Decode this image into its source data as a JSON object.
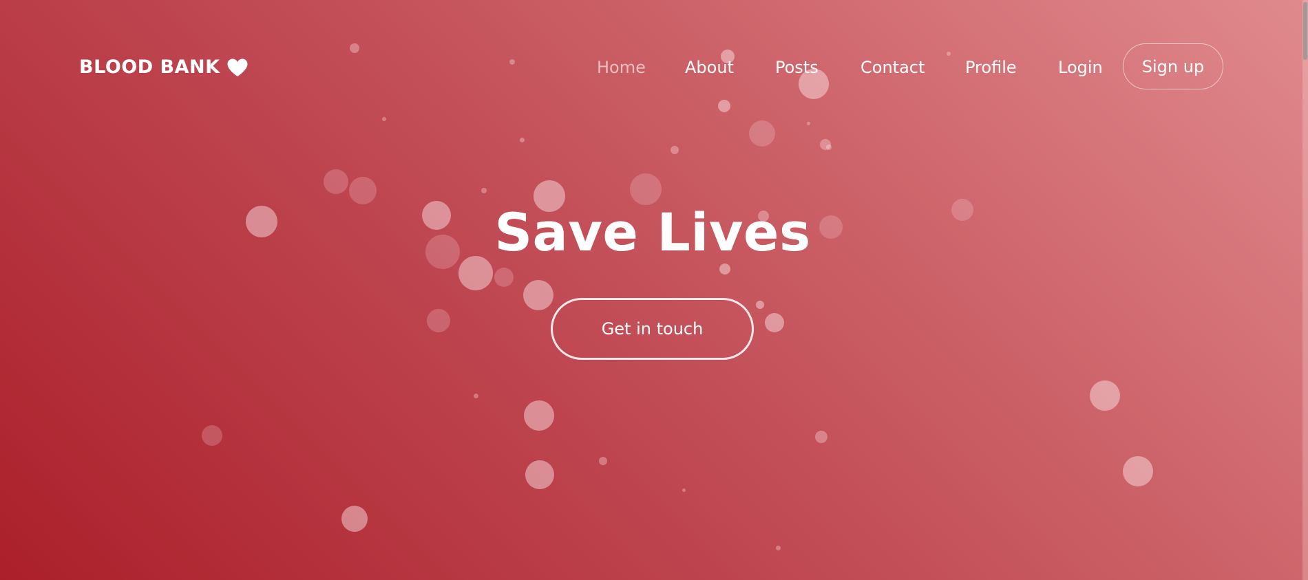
{
  "brand": {
    "name": "BLOOD BANK",
    "icon": "heart-icon"
  },
  "nav": {
    "items": [
      {
        "label": "Home",
        "active": true
      },
      {
        "label": "About",
        "active": false
      },
      {
        "label": "Posts",
        "active": false
      },
      {
        "label": "Contact",
        "active": false
      },
      {
        "label": "Profile",
        "active": false
      },
      {
        "label": "Login",
        "active": false
      }
    ],
    "signup_label": "Sign up"
  },
  "hero": {
    "title": "Save Lives",
    "cta_label": "Get in touch"
  },
  "colors": {
    "gradient_start": "#ab1f2a",
    "gradient_end": "#e08a8e",
    "text": "#ffffff"
  }
}
